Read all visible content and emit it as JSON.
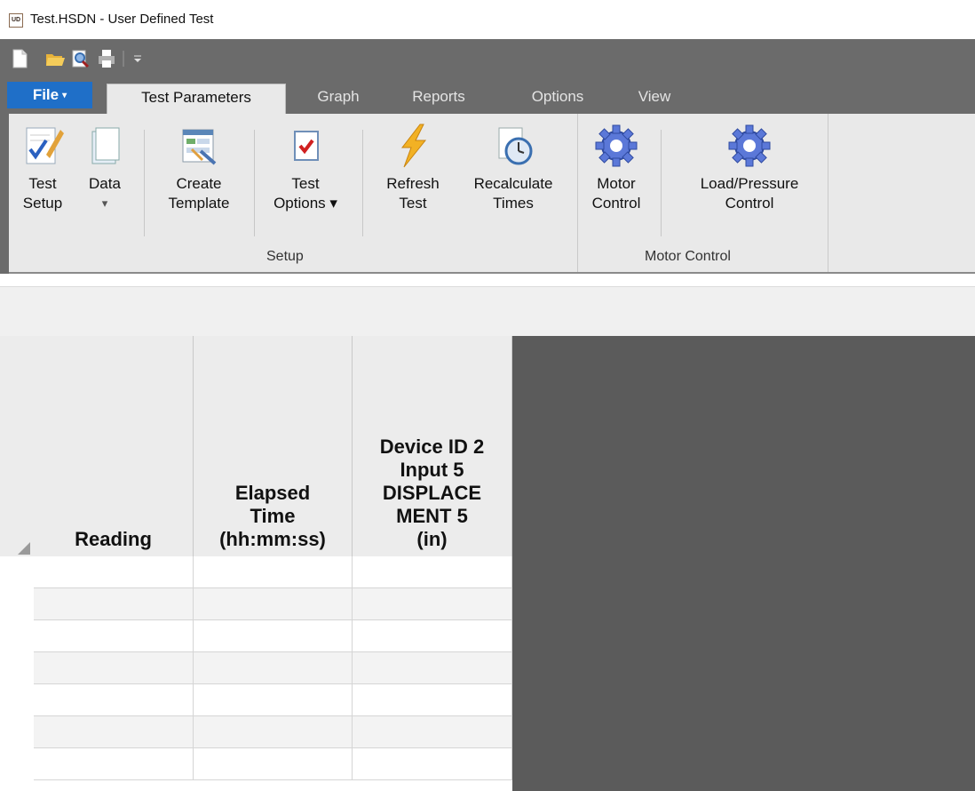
{
  "window": {
    "title": "Test.HSDN - User Defined Test",
    "icon_text": "UD"
  },
  "quick_access": [
    "new-file-icon",
    "open-folder-icon",
    "print-preview-icon",
    "print-icon",
    "customize-dropdown-icon"
  ],
  "tabs": {
    "file": "File",
    "items": [
      "Test Parameters",
      "Graph",
      "Reports",
      "Options",
      "View"
    ],
    "active": "Test Parameters"
  },
  "ribbon": {
    "groups": [
      {
        "label": "Setup"
      },
      {
        "label": "Motor Control"
      }
    ],
    "buttons": {
      "test_setup": {
        "line1": "Test",
        "line2": "Setup"
      },
      "data": {
        "line1": "Data",
        "line2": "▾"
      },
      "create_template": {
        "line1": "Create",
        "line2": "Template"
      },
      "test_options": {
        "line1": "Test",
        "line2": "Options ▾"
      },
      "refresh_test": {
        "line1": "Refresh",
        "line2": "Test"
      },
      "recalculate_times": {
        "line1": "Recalculate",
        "line2": "Times"
      },
      "motor_control": {
        "line1": "Motor",
        "line2": "Control"
      },
      "load_pressure_control": {
        "line1": "Load/Pressure",
        "line2": "Control"
      }
    }
  },
  "grid": {
    "columns": [
      {
        "header": [
          "Reading"
        ]
      },
      {
        "header": [
          "Elapsed",
          "Time",
          "(hh:mm:ss)"
        ]
      },
      {
        "header": [
          "Device ID 2",
          "Input 5",
          "DISPLACE",
          "MENT 5",
          "(in)"
        ]
      }
    ],
    "rows": [
      [
        "",
        "",
        ""
      ],
      [
        "",
        "",
        ""
      ],
      [
        "",
        "",
        ""
      ],
      [
        "",
        "",
        ""
      ],
      [
        "",
        "",
        ""
      ],
      [
        "",
        "",
        ""
      ],
      [
        "",
        "",
        ""
      ]
    ]
  },
  "colors": {
    "accent": "#1f6fc8",
    "dark_panel": "#5b5b5b",
    "ribbon_bg": "#e9e9e9"
  }
}
